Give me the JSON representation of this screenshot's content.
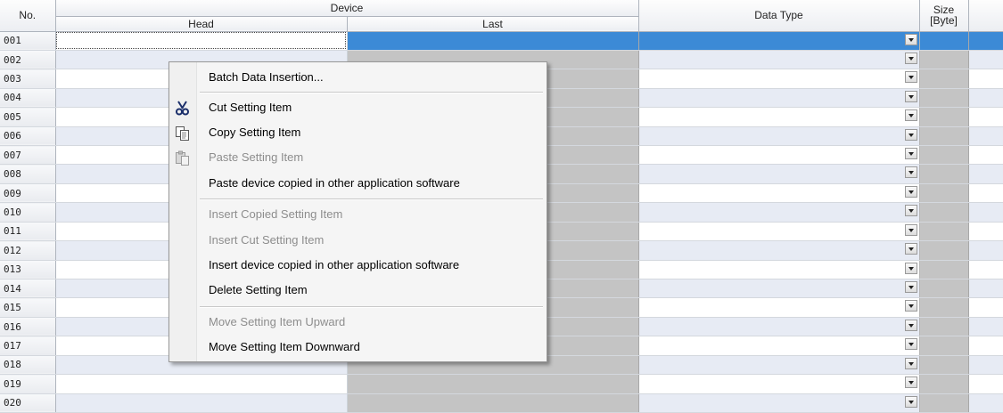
{
  "columns": {
    "no": "No.",
    "device": "Device",
    "head": "Head",
    "last": "Last",
    "data_type": "Data Type",
    "size_line1": "Size",
    "size_line2": "[Byte]"
  },
  "rows": [
    "001",
    "002",
    "003",
    "004",
    "005",
    "006",
    "007",
    "008",
    "009",
    "010",
    "011",
    "012",
    "013",
    "014",
    "015",
    "016",
    "017",
    "018",
    "019",
    "020"
  ],
  "selected_row": "001",
  "colors": {
    "selection": "#3c8ad6",
    "readonly_cell": "#c4c4c4",
    "alt_row": "#e7ebf4"
  },
  "context_menu": {
    "items": [
      {
        "label": "Batch Data Insertion...",
        "enabled": true
      },
      {
        "label": "Cut Setting Item",
        "enabled": true,
        "icon": "scissors-icon"
      },
      {
        "label": "Copy Setting Item",
        "enabled": true,
        "icon": "copy-icon"
      },
      {
        "label": "Paste Setting Item",
        "enabled": false,
        "icon": "paste-icon"
      },
      {
        "label": "Paste device copied in other application software",
        "enabled": true
      },
      {
        "label": "Insert Copied Setting Item",
        "enabled": false
      },
      {
        "label": "Insert Cut Setting Item",
        "enabled": false
      },
      {
        "label": "Insert device copied in other application software",
        "enabled": true
      },
      {
        "label": "Delete Setting Item",
        "enabled": true
      },
      {
        "label": "Move Setting Item Upward",
        "enabled": false
      },
      {
        "label": "Move Setting Item Downward",
        "enabled": true
      }
    ]
  }
}
